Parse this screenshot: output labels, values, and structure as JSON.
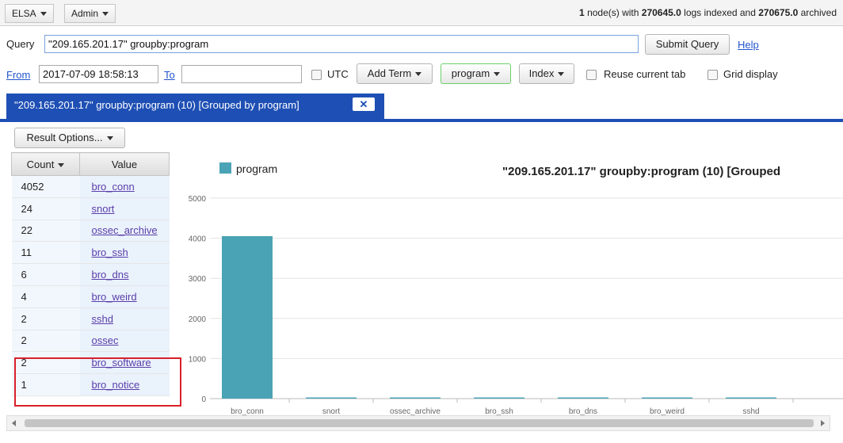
{
  "menubar": {
    "elsa_label": "ELSA",
    "admin_label": "Admin",
    "status": {
      "nodes": "1",
      "nodes_text": " node(s) with ",
      "logs_indexed": "270645.0",
      "indexed_text": " logs indexed and ",
      "archived_count": "270675.0",
      "archived_text": " archived"
    }
  },
  "query_bar": {
    "label": "Query",
    "value": "\"209.165.201.17\" groupby:program",
    "submit_label": "Submit Query",
    "help_label": "Help"
  },
  "filters": {
    "from_label": "From",
    "from_value": "2017-07-09 18:58:13",
    "to_label": "To",
    "to_value": "",
    "utc_label": "UTC",
    "add_term_label": "Add Term",
    "program_label": "program",
    "index_label": "Index",
    "reuse_tab_label": "Reuse current tab",
    "grid_display_label": "Grid display"
  },
  "tab": {
    "label": "\"209.165.201.17\" groupby:program (10) [Grouped by program]",
    "close_label": "✕"
  },
  "result_options_label": "Result Options...",
  "results_table": {
    "count_header": "Count",
    "value_header": "Value",
    "rows": [
      {
        "count": "4052",
        "value": "bro_conn"
      },
      {
        "count": "24",
        "value": "snort"
      },
      {
        "count": "22",
        "value": "ossec_archive"
      },
      {
        "count": "11",
        "value": "bro_ssh"
      },
      {
        "count": "6",
        "value": "bro_dns"
      },
      {
        "count": "4",
        "value": "bro_weird"
      },
      {
        "count": "2",
        "value": "sshd"
      },
      {
        "count": "2",
        "value": "ossec"
      },
      {
        "count": "2",
        "value": "bro_software"
      },
      {
        "count": "1",
        "value": "bro_notice"
      }
    ]
  },
  "chart_data": {
    "type": "bar",
    "title": "\"209.165.201.17\" groupby:program (10) [Grouped",
    "legend": "program",
    "categories": [
      "bro_conn",
      "snort",
      "ossec_archive",
      "bro_ssh",
      "bro_dns",
      "bro_weird",
      "sshd"
    ],
    "values": [
      4052,
      24,
      22,
      11,
      6,
      4,
      2
    ],
    "ylim": [
      0,
      5000
    ],
    "yticks": [
      0,
      1000,
      2000,
      3000,
      4000,
      5000
    ],
    "grid": true,
    "legend_position": "top-left",
    "bar_color": "#4aa3b4"
  },
  "colors": {
    "accent": "#1e4fb4",
    "highlight_box": "#d9202a"
  }
}
